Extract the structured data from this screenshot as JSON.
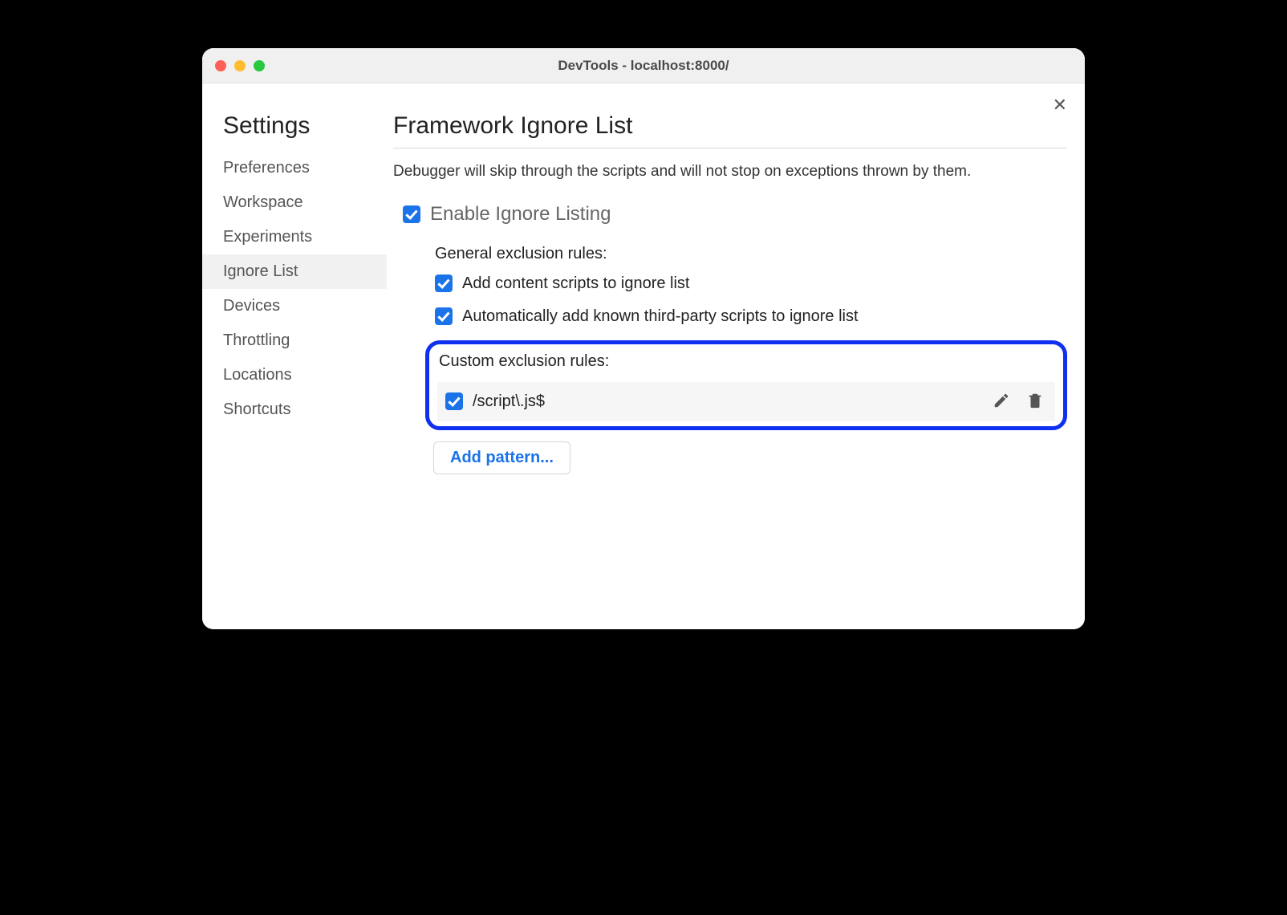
{
  "window": {
    "title": "DevTools - localhost:8000/"
  },
  "sidebar": {
    "title": "Settings",
    "items": [
      {
        "label": "Preferences",
        "active": false
      },
      {
        "label": "Workspace",
        "active": false
      },
      {
        "label": "Experiments",
        "active": false
      },
      {
        "label": "Ignore List",
        "active": true
      },
      {
        "label": "Devices",
        "active": false
      },
      {
        "label": "Throttling",
        "active": false
      },
      {
        "label": "Locations",
        "active": false
      },
      {
        "label": "Shortcuts",
        "active": false
      }
    ]
  },
  "main": {
    "title": "Framework Ignore List",
    "description": "Debugger will skip through the scripts and will not stop on exceptions thrown by them.",
    "enable_label": "Enable Ignore Listing",
    "enable_checked": true,
    "general_header": "General exclusion rules:",
    "general_rules": [
      {
        "label": "Add content scripts to ignore list",
        "checked": true
      },
      {
        "label": "Automatically add known third-party scripts to ignore list",
        "checked": true
      }
    ],
    "custom_header": "Custom exclusion rules:",
    "custom_rules": [
      {
        "pattern": "/script\\.js$",
        "checked": true
      }
    ],
    "add_pattern_label": "Add pattern..."
  }
}
